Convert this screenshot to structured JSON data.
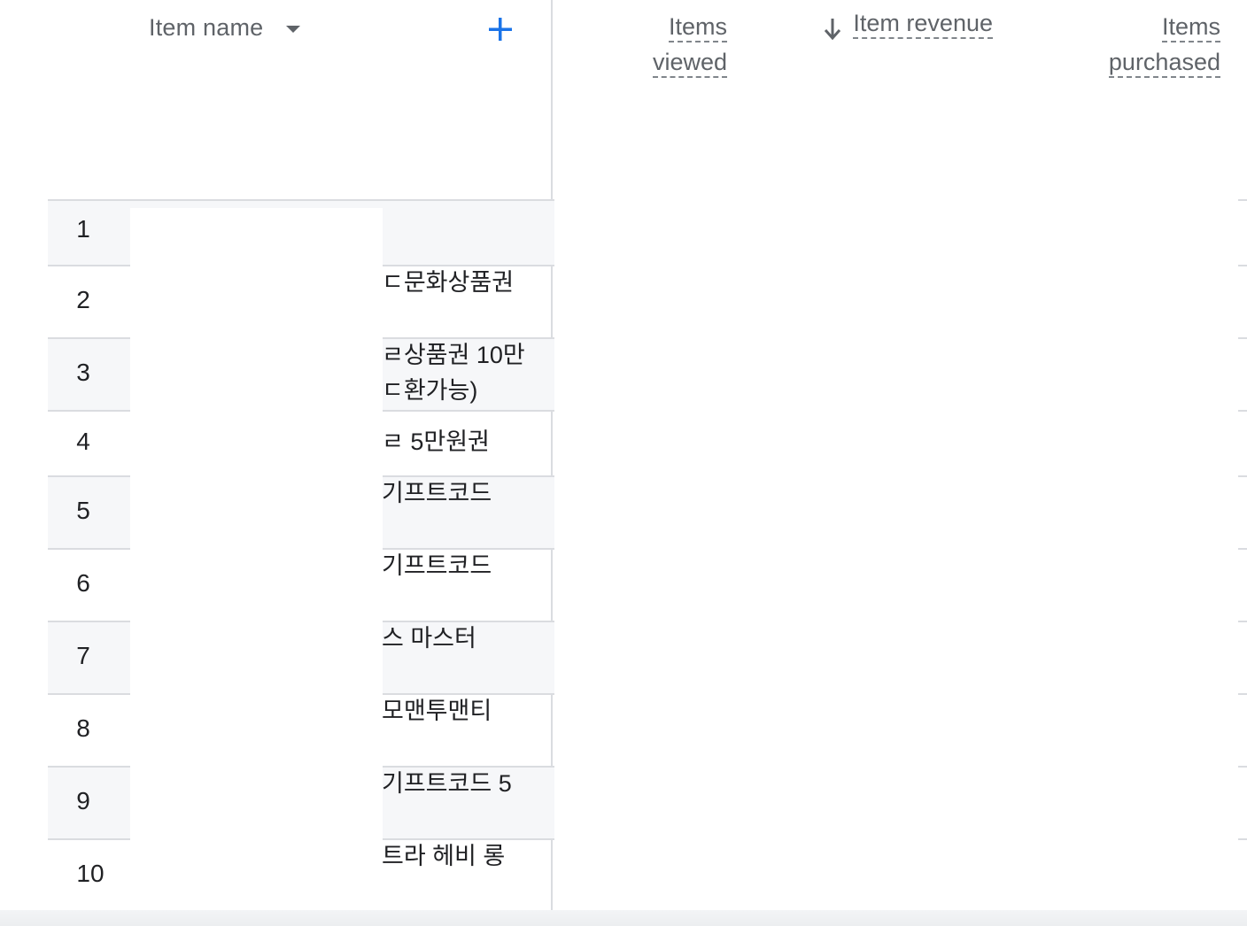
{
  "header": {
    "dimension_label": "Item name",
    "add_label": "+",
    "metrics": [
      {
        "line1": "Items",
        "line2": "viewed"
      },
      {
        "label": "Item revenue",
        "sorted": "descending"
      },
      {
        "line1": "Items",
        "line2": "purchased"
      }
    ]
  },
  "rows": [
    {
      "index": "1",
      "name": ""
    },
    {
      "index": "2",
      "name": "ㄷ문화상품권"
    },
    {
      "index": "3",
      "name": "ㄹ상품권 10만\nㄷ환가능)"
    },
    {
      "index": "4",
      "name": "ㄹ 5만원권"
    },
    {
      "index": "5",
      "name": "기프트코드"
    },
    {
      "index": "6",
      "name": "기프트코드"
    },
    {
      "index": "7",
      "name": "스 마스터"
    },
    {
      "index": "8",
      "name": "모맨투맨티"
    },
    {
      "index": "9",
      "name": "기프트코드 5"
    },
    {
      "index": "10",
      "name": "트라 헤비 롱"
    }
  ]
}
